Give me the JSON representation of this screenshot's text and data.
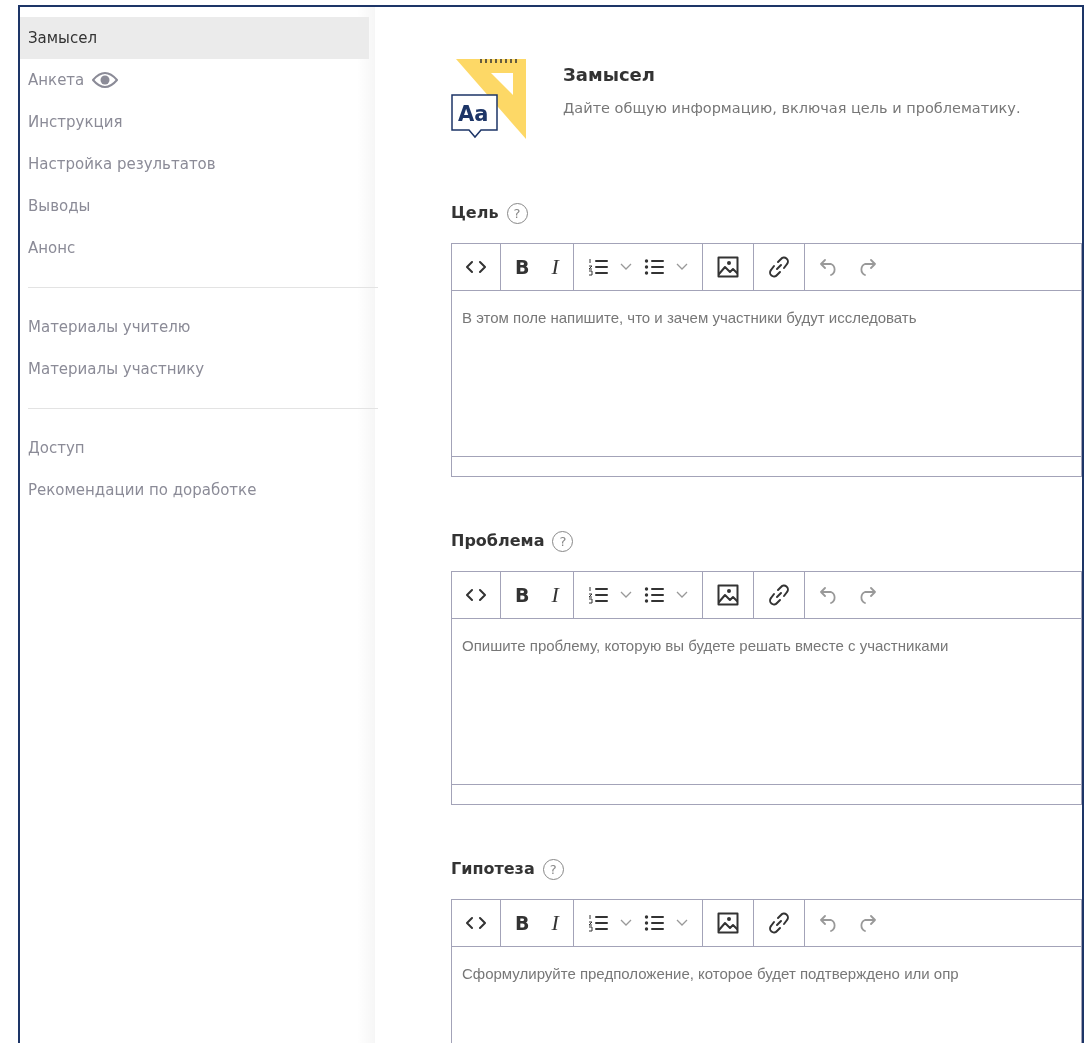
{
  "sidebar": {
    "groups": [
      {
        "items": [
          {
            "label": "Замысел",
            "selected": true,
            "has_eye": false
          },
          {
            "label": "Анкета",
            "selected": false,
            "has_eye": true
          },
          {
            "label": "Инструкция",
            "selected": false,
            "has_eye": false
          },
          {
            "label": "Настройка результатов",
            "selected": false,
            "has_eye": false
          },
          {
            "label": "Выводы",
            "selected": false,
            "has_eye": false
          },
          {
            "label": "Анонс",
            "selected": false,
            "has_eye": false
          }
        ]
      },
      {
        "items": [
          {
            "label": "Материалы учителю",
            "selected": false,
            "has_eye": false
          },
          {
            "label": "Материалы участнику",
            "selected": false,
            "has_eye": false
          }
        ]
      },
      {
        "items": [
          {
            "label": "Доступ",
            "selected": false,
            "has_eye": false
          },
          {
            "label": "Рекомендации по доработке",
            "selected": false,
            "has_eye": false
          }
        ]
      }
    ]
  },
  "section": {
    "icon_label": "Aa",
    "title": "Замысел",
    "subtitle": "Дайте общую информацию, включая цель и проблематику."
  },
  "fields": [
    {
      "label": "Цель",
      "help_mark": "?",
      "bold_key": "B",
      "italic_key": "I",
      "placeholder": "В этом поле напишите, что и зачем участники будут исследовать"
    },
    {
      "label": "Проблема",
      "help_mark": "?",
      "bold_key": "B",
      "italic_key": "I",
      "placeholder": "Опишите проблему, которую вы будете решать вместе с участниками"
    },
    {
      "label": "Гипотеза",
      "help_mark": "?",
      "bold_key": "B",
      "italic_key": "I",
      "placeholder": "Сформулируйте предположение, которое будет подтверждено или опр"
    }
  ]
}
